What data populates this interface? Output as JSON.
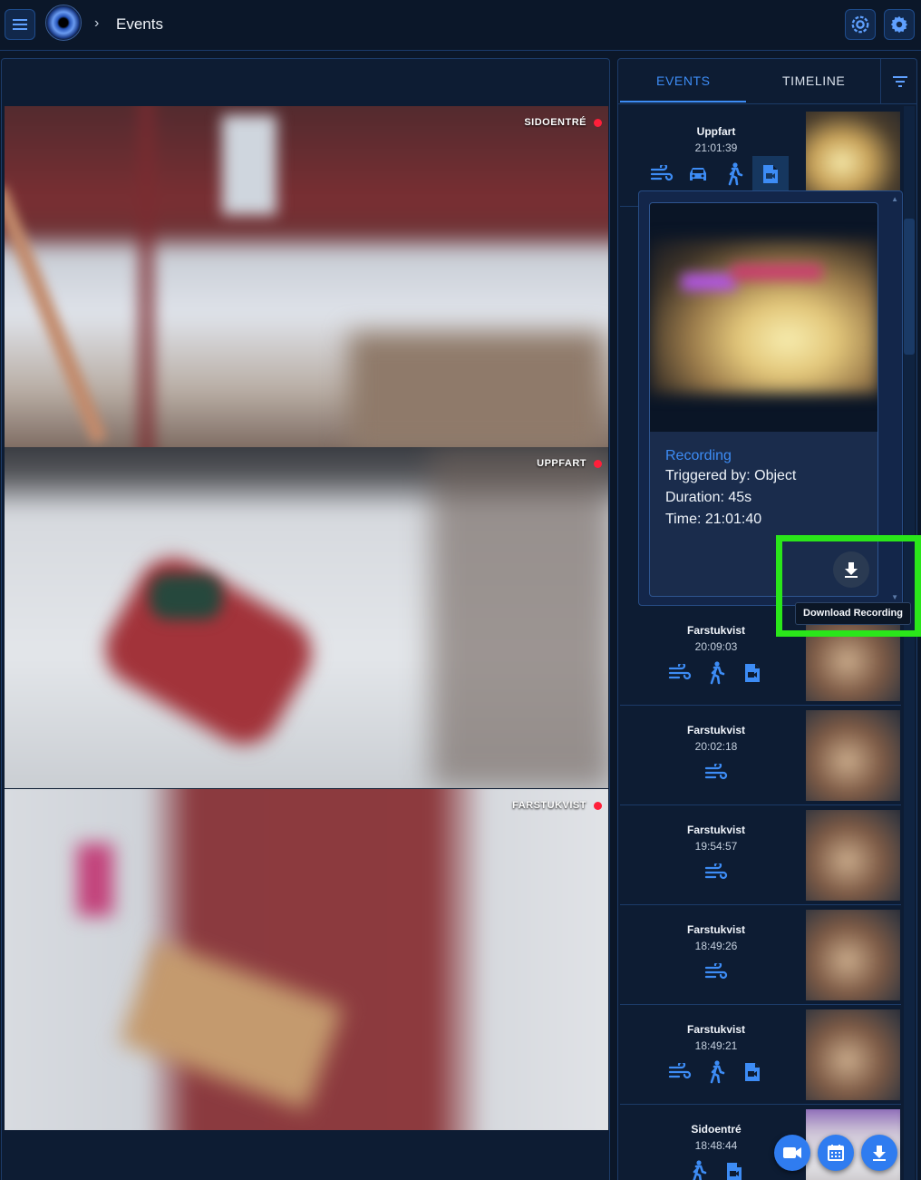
{
  "header": {
    "breadcrumb_title": "Events",
    "icons": [
      "menu-icon",
      "logo-eye",
      "chevron-right-icon",
      "camera-settings-icon",
      "gear-icon"
    ]
  },
  "cameras": [
    {
      "label": "SIDOENTRÉ"
    },
    {
      "label": "UPPFART"
    },
    {
      "label": "FARSTUKVIST"
    }
  ],
  "tabs": {
    "events": "EVENTS",
    "timeline": "TIMELINE"
  },
  "events": [
    {
      "camera": "Uppfart",
      "time": "21:01:39"
    },
    {
      "camera": "Farstukvist",
      "time": "20:09:03"
    },
    {
      "camera": "Farstukvist",
      "time": "20:02:18"
    },
    {
      "camera": "Farstukvist",
      "time": "19:54:57"
    },
    {
      "camera": "Farstukvist",
      "time": "18:49:26"
    },
    {
      "camera": "Farstukvist",
      "time": "18:49:21"
    },
    {
      "camera": "Sidoentré",
      "time": "18:48:44"
    }
  ],
  "popup": {
    "title": "Recording",
    "triggered": "Triggered by: Object",
    "duration": "Duration: 45s",
    "time": "Time: 21:01:40",
    "tooltip": "Download Recording"
  },
  "colors": {
    "accent": "#3d8cf5",
    "highlight": "#2ae61a",
    "live_dot": "#ff1f3a",
    "background": "#0b1729"
  }
}
